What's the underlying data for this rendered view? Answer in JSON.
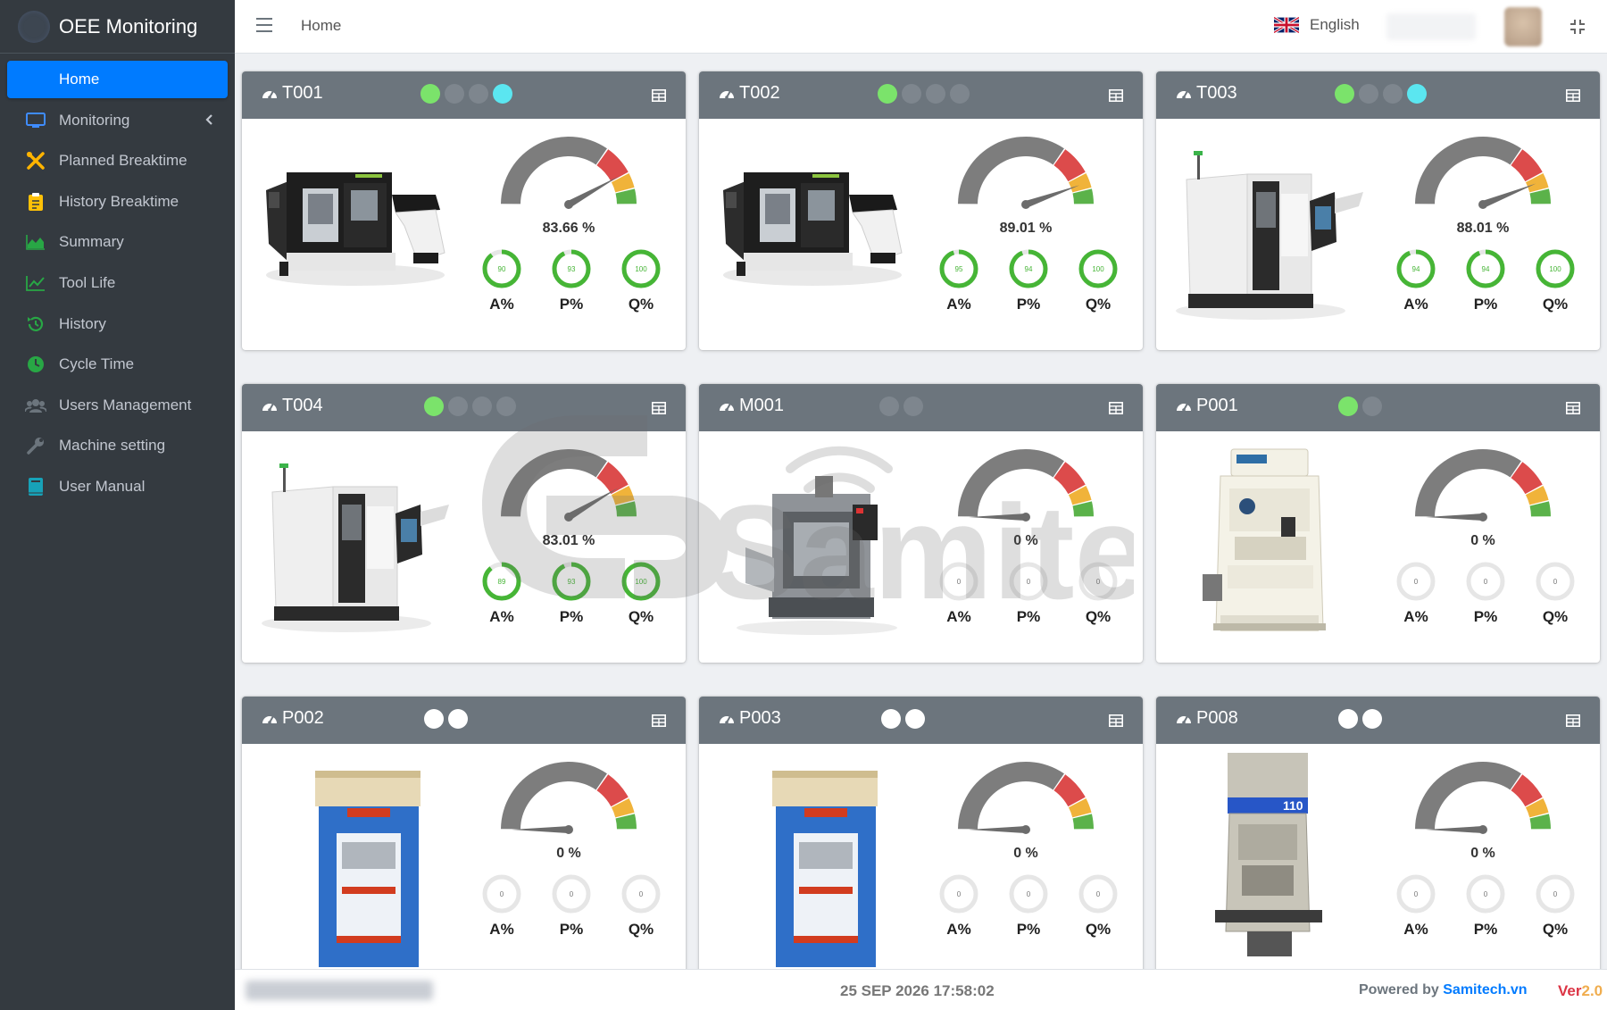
{
  "app": {
    "title": "OEE Monitoring"
  },
  "nav": [
    {
      "label": "Home",
      "icon": "home-icon",
      "active": true
    },
    {
      "label": "Monitoring",
      "icon": "monitor-icon",
      "color": "#3f8cff"
    },
    {
      "label": "Planned Breaktime",
      "icon": "tools-icon",
      "color": "#ffb400"
    },
    {
      "label": "History Breaktime",
      "icon": "clipboard-icon",
      "color": "#ffc107"
    },
    {
      "label": "Summary",
      "icon": "area-chart-icon",
      "color": "#28a745"
    },
    {
      "label": "Tool Life",
      "icon": "line-chart-icon",
      "color": "#28a745"
    },
    {
      "label": "History",
      "icon": "history-icon",
      "color": "#28a745"
    },
    {
      "label": "Cycle Time",
      "icon": "clock-icon",
      "color": "#28a745"
    },
    {
      "label": "Users Management",
      "icon": "users-icon",
      "color": "#6c757d"
    },
    {
      "label": "Machine setting",
      "icon": "wrench-icon",
      "color": "#6c757d"
    },
    {
      "label": "User Manual",
      "icon": "book-icon",
      "color": "#17a2b8"
    }
  ],
  "header": {
    "breadcrumb": "Home",
    "language": "English"
  },
  "machines": [
    {
      "name": "T001",
      "type": "lathe",
      "dots": [
        "g",
        "x",
        "x",
        "c"
      ],
      "oee": "83.66 %",
      "oee_value": 83.66,
      "a": 90,
      "p": 93,
      "q": 100
    },
    {
      "name": "T002",
      "type": "lathe",
      "dots": [
        "g",
        "x",
        "x",
        "x"
      ],
      "oee": "89.01 %",
      "oee_value": 89.01,
      "a": 95,
      "p": 94,
      "q": 100
    },
    {
      "name": "T003",
      "type": "lathe2",
      "dots": [
        "g",
        "x",
        "x",
        "c"
      ],
      "oee": "88.01 %",
      "oee_value": 88.01,
      "a": 94,
      "p": 94,
      "q": 100
    },
    {
      "name": "T004",
      "type": "lathe2",
      "dots": [
        "g",
        "x",
        "x",
        "x"
      ],
      "oee": "83.01 %",
      "oee_value": 83.01,
      "a": 89,
      "p": 93,
      "q": 100
    },
    {
      "name": "M001",
      "type": "mill",
      "dots": [
        "x",
        "x"
      ],
      "oee": "0 %",
      "oee_value": 0,
      "a": 0,
      "p": 0,
      "q": 0
    },
    {
      "name": "P001",
      "type": "press-white",
      "dots": [
        "g",
        "x"
      ],
      "oee": "0 %",
      "oee_value": 0,
      "a": 0,
      "p": 0,
      "q": 0
    },
    {
      "name": "P002",
      "type": "press-blue",
      "dots": [
        "w",
        "w"
      ],
      "oee": "0 %",
      "oee_value": 0,
      "a": 0,
      "p": 0,
      "q": 0
    },
    {
      "name": "P003",
      "type": "press-blue",
      "dots": [
        "w",
        "w"
      ],
      "oee": "0 %",
      "oee_value": 0,
      "a": 0,
      "p": 0,
      "q": 0
    },
    {
      "name": "P008",
      "type": "press-grey",
      "dots": [
        "w",
        "w"
      ],
      "oee": "0 %",
      "oee_value": 0,
      "a": 0,
      "p": 0,
      "q": 0
    }
  ],
  "labels": {
    "a": "A%",
    "p": "P%",
    "q": "Q%"
  },
  "watermark": "Samitech",
  "footer": {
    "datetime": "25 SEP 2026 17:58:02",
    "powered_prefix": "Powered by ",
    "powered_brand": "Samitech.vn",
    "ver_prefix": "Ver",
    "ver_num": "2.0"
  },
  "colors": {
    "accent": "#007bff",
    "green": "#28a745",
    "red": "#dc3545",
    "orange": "#f0ad4e",
    "yellow": "#ffc107",
    "sidebar": "#343a40",
    "card_head": "#6c757d"
  }
}
